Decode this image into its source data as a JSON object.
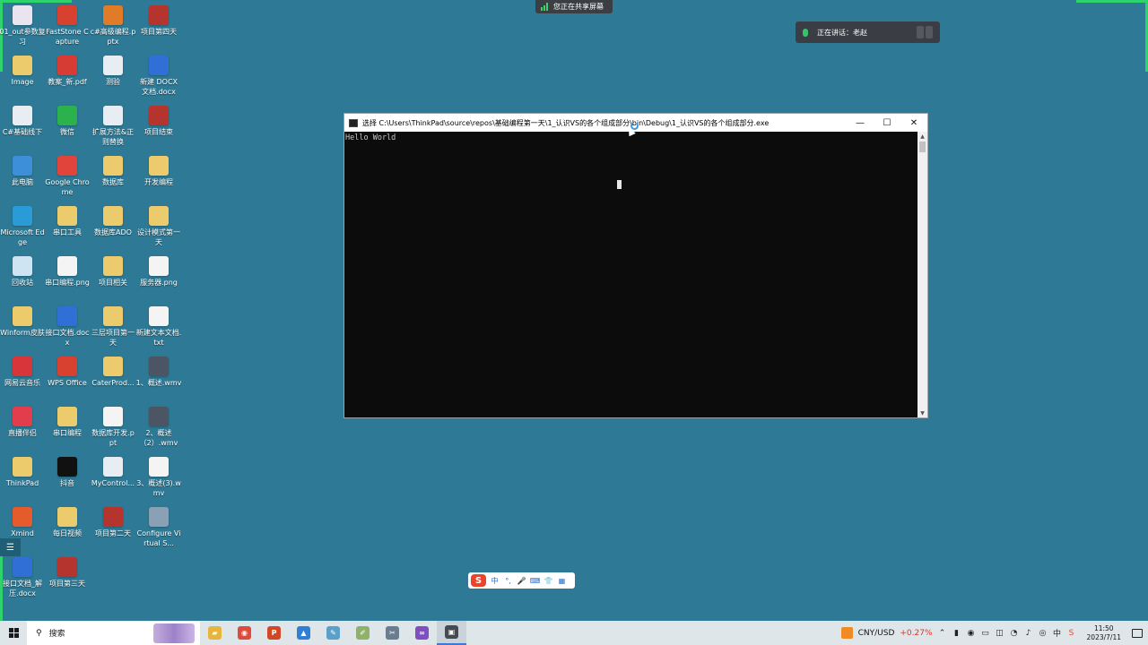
{
  "desktop": {
    "icons": [
      {
        "label": "01_out参数复习",
        "icon": "document-icon",
        "color": "#e9e4ef"
      },
      {
        "label": "FastStone Capture",
        "icon": "faststone-icon",
        "color": "#d8402f"
      },
      {
        "label": "c#高级编程.pptx",
        "icon": "pptx-icon",
        "color": "#e07b28"
      },
      {
        "label": "项目第四天",
        "icon": "archive-icon",
        "color": "#b5342d"
      },
      {
        "label": "Image",
        "icon": "folder-icon",
        "color": "#eccb6c"
      },
      {
        "label": "教案_新.pdf",
        "icon": "pdf-icon",
        "color": "#d63c34"
      },
      {
        "label": "测验",
        "icon": "document-icon",
        "color": "#e8edf4"
      },
      {
        "label": "新建 DOCX 文档.docx",
        "icon": "word-icon",
        "color": "#2f6fd6"
      },
      {
        "label": "C#基础线下",
        "icon": "document-icon",
        "color": "#e8edf4"
      },
      {
        "label": "微信",
        "icon": "wechat-icon",
        "color": "#2bb24c"
      },
      {
        "label": "扩展方法&正则替换",
        "icon": "document-icon",
        "color": "#e8edf4"
      },
      {
        "label": "项目结束",
        "icon": "archive-icon",
        "color": "#b5342d"
      },
      {
        "label": "此电脑",
        "icon": "computer-icon",
        "color": "#3d8fd9"
      },
      {
        "label": "Google Chrome",
        "icon": "chrome-icon",
        "color": "#e0443a"
      },
      {
        "label": "数据库",
        "icon": "folder-icon",
        "color": "#eccb6c"
      },
      {
        "label": "开发编程",
        "icon": "folder-icon",
        "color": "#eccb6c"
      },
      {
        "label": "Microsoft Edge",
        "icon": "edge-icon",
        "color": "#2a9bd6"
      },
      {
        "label": "串口工具",
        "icon": "folder-icon",
        "color": "#eccb6c"
      },
      {
        "label": "数据库ADO",
        "icon": "folder-icon",
        "color": "#eccb6c"
      },
      {
        "label": "设计模式第一天",
        "icon": "folder-icon",
        "color": "#eccb6c"
      },
      {
        "label": "回收站",
        "icon": "recycle-bin-icon",
        "color": "#cfe4f2"
      },
      {
        "label": "串口编程.png",
        "icon": "image-file-icon",
        "color": "#f4f4f4"
      },
      {
        "label": "项目相关",
        "icon": "folder-icon",
        "color": "#eccb6c"
      },
      {
        "label": "服务器.png",
        "icon": "image-file-icon",
        "color": "#f4f4f4"
      },
      {
        "label": "Winform皮肤",
        "icon": "folder-icon",
        "color": "#eccb6c"
      },
      {
        "label": "接口文档.docx",
        "icon": "word-icon",
        "color": "#2f6fd6"
      },
      {
        "label": "三层项目第一天",
        "icon": "folder-icon",
        "color": "#eccb6c"
      },
      {
        "label": "新建文本文档.txt",
        "icon": "text-file-icon",
        "color": "#f4f4f4"
      },
      {
        "label": "网易云音乐",
        "icon": "netease-music-icon",
        "color": "#d8353a"
      },
      {
        "label": "WPS Office",
        "icon": "wps-icon",
        "color": "#d8402f"
      },
      {
        "label": "CaterProd...",
        "icon": "folder-icon",
        "color": "#eccb6c"
      },
      {
        "label": "1、概述.wmv",
        "icon": "video-file-icon",
        "color": "#4b5563"
      },
      {
        "label": "直播伴侣",
        "icon": "live-companion-icon",
        "color": "#e23d4a"
      },
      {
        "label": "串口编程",
        "icon": "folder-icon",
        "color": "#eccb6c"
      },
      {
        "label": "数据库开发.ppt",
        "icon": "pptx-icon",
        "color": "#f4f4f4"
      },
      {
        "label": "2、概述（2）.wmv",
        "icon": "video-file-icon",
        "color": "#4b5563"
      },
      {
        "label": "ThinkPad",
        "icon": "folder-icon",
        "color": "#eccb6c"
      },
      {
        "label": "抖音",
        "icon": "douyin-icon",
        "color": "#111111"
      },
      {
        "label": "MyControl...",
        "icon": "document-icon",
        "color": "#e8edf4"
      },
      {
        "label": "3、概述(3).wmv",
        "icon": "video-file-icon",
        "color": "#f4f4f4"
      },
      {
        "label": "Xmind",
        "icon": "xmind-icon",
        "color": "#e55b2c"
      },
      {
        "label": "每日视频",
        "icon": "folder-icon",
        "color": "#eccb6c"
      },
      {
        "label": "项目第二天",
        "icon": "archive-icon",
        "color": "#b5342d"
      },
      {
        "label": "Configure Virtual S...",
        "icon": "configure-icon",
        "color": "#8aa0b5"
      },
      {
        "label": "接口文档_解压.docx",
        "icon": "word-icon",
        "color": "#2f6fd6"
      },
      {
        "label": "项目第三天",
        "icon": "archive-icon",
        "color": "#b5342d"
      }
    ]
  },
  "share_bar": {
    "label": "您正在共享屏幕"
  },
  "speaking_bar": {
    "label": "正在讲话：老赵"
  },
  "console": {
    "title": "选择 C:\\Users\\ThinkPad\\source\\repos\\基础编程第一天\\1_认识VS的各个组成部分\\bin\\Debug\\1_认识VS的各个组成部分.exe",
    "output": "Hello World",
    "minimize": "—",
    "maximize": "☐",
    "close": "✕"
  },
  "ime": {
    "logo": "S",
    "mode": "中",
    "items": [
      "°,",
      "🎤",
      "⌨",
      "👕",
      "▦"
    ]
  },
  "taskbar": {
    "search_placeholder": "搜索",
    "apps": [
      {
        "name": "file-explorer",
        "glyph": "▰",
        "color": "#e6b53c"
      },
      {
        "name": "chrome",
        "glyph": "◉",
        "color": "#de4a3b"
      },
      {
        "name": "powerpoint",
        "glyph": "P",
        "color": "#d24726"
      },
      {
        "name": "photos",
        "glyph": "▲",
        "color": "#2f7fd6"
      },
      {
        "name": "notepad",
        "glyph": "✎",
        "color": "#5aa0c8"
      },
      {
        "name": "paint",
        "glyph": "✐",
        "color": "#8fb26a"
      },
      {
        "name": "snipping",
        "glyph": "✂",
        "color": "#6a7c8f"
      },
      {
        "name": "visual-studio",
        "glyph": "∞",
        "color": "#7f4fbf"
      },
      {
        "name": "console",
        "glyph": "▣",
        "color": "#444b52"
      }
    ],
    "fx_pair": "CNY/USD",
    "fx_change": "+0.27%",
    "time": "11:50",
    "date": "2023/7/11"
  }
}
